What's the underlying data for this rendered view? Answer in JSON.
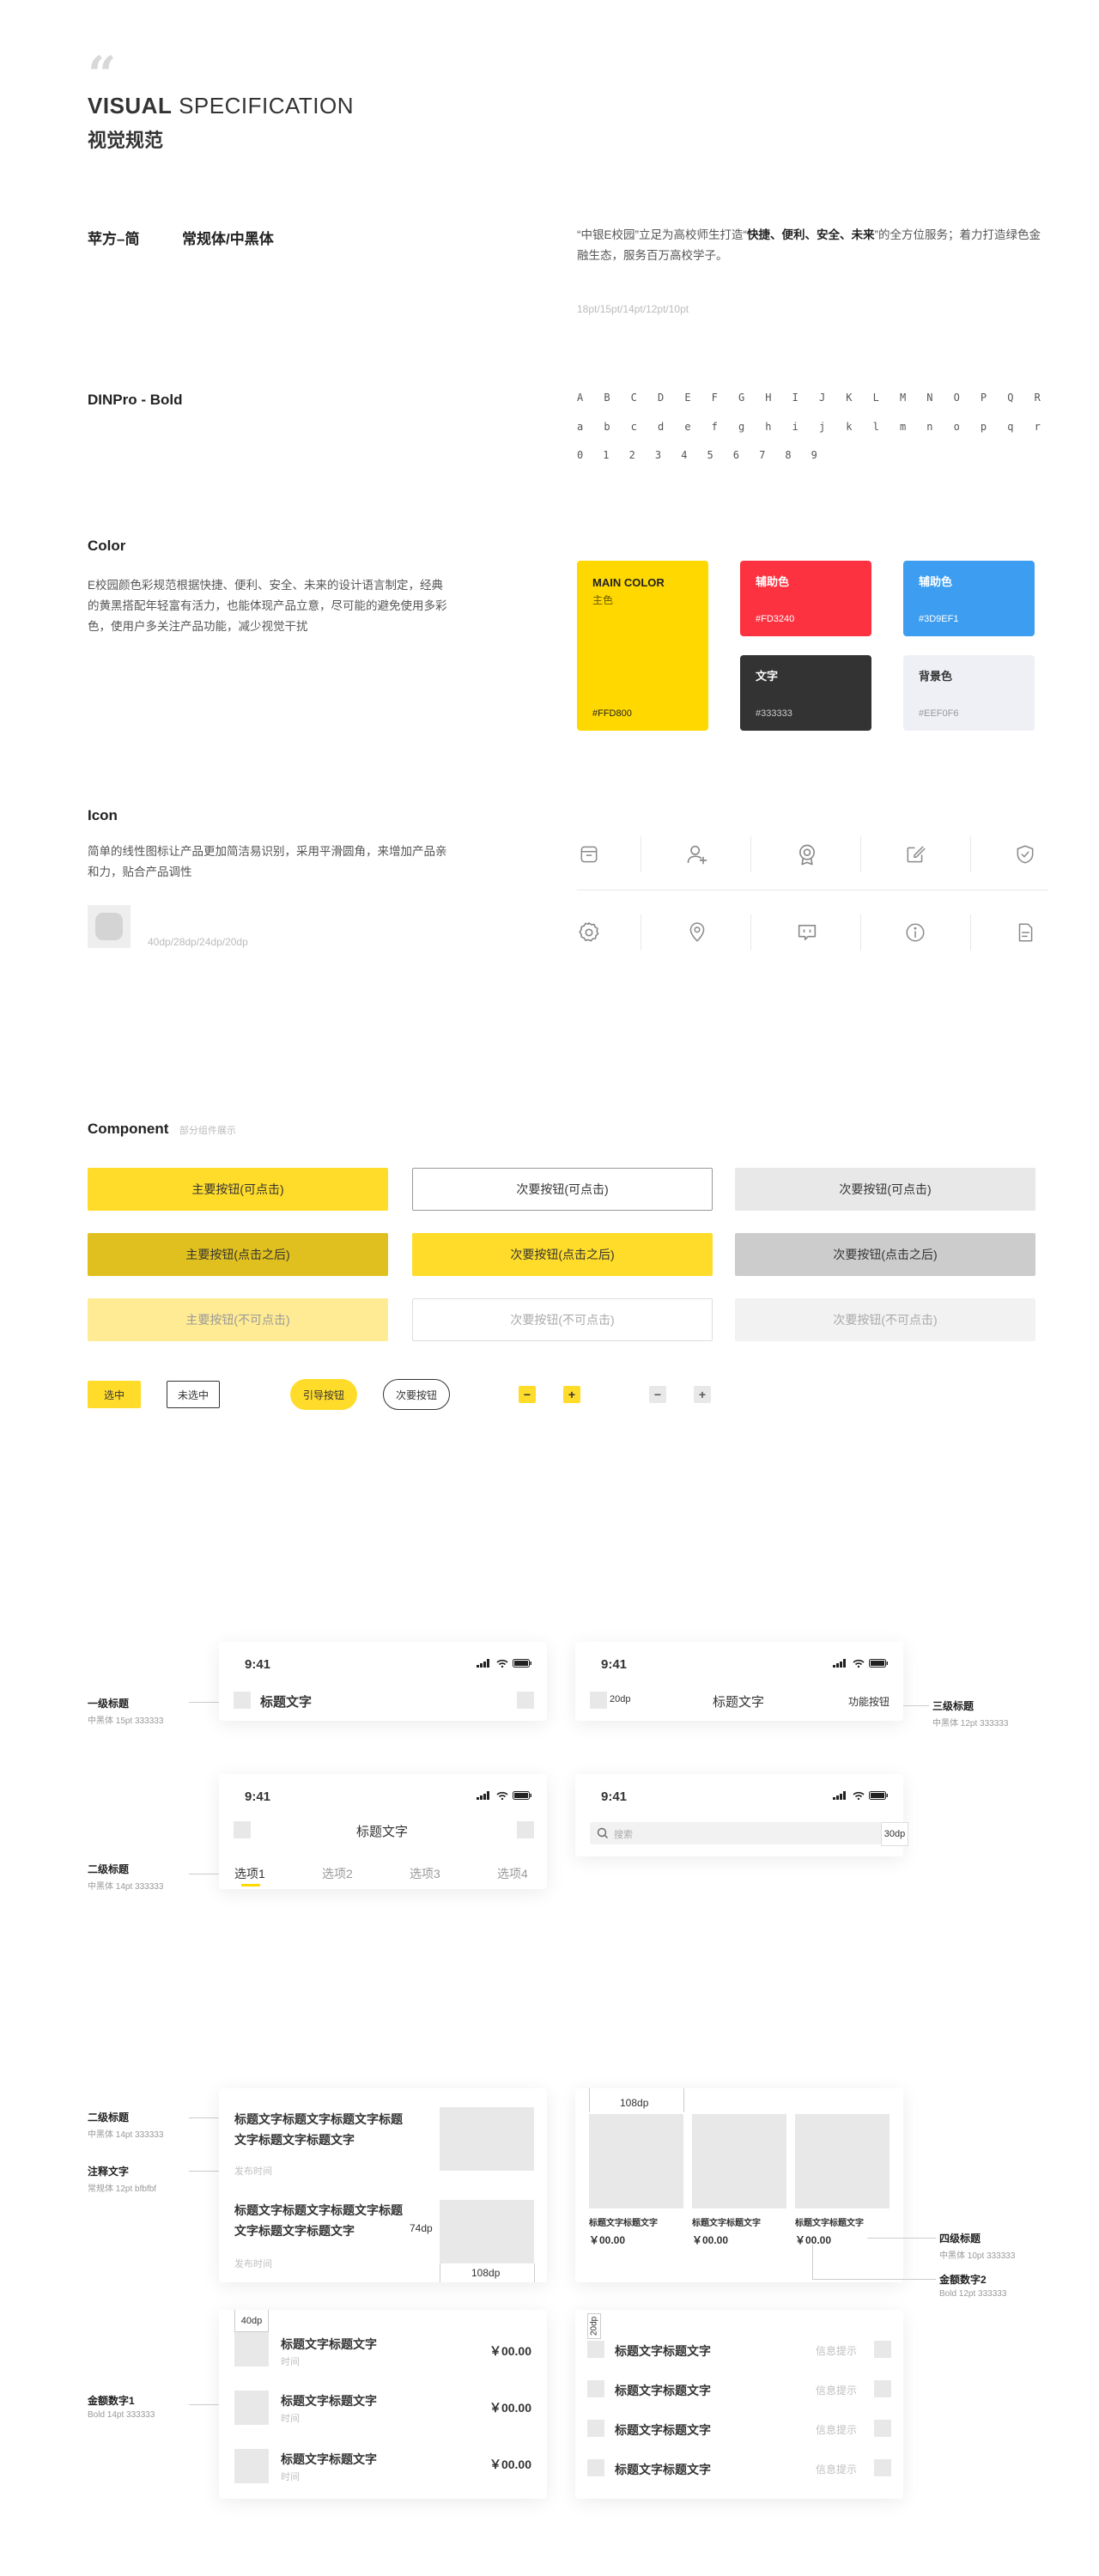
{
  "header": {
    "title_bold": "VISUAL",
    "title_rest": " SPECIFICATION",
    "subtitle": "视觉规范"
  },
  "fonts": {
    "cn_name": "苹方–简",
    "cn_weights": "常规体/中黑体",
    "sample_pre": "“中银E校园”立足为高校师生打造“",
    "sample_bold": "快捷、便利、安全、未来",
    "sample_post": "”的全方位服务；着力打造绿色金融生态，服务百万高校学子。",
    "sizes": "18pt/15pt/14pt/12pt/10pt",
    "din_name": "DINPro - Bold",
    "upper": [
      "A",
      "B",
      "C",
      "D",
      "E",
      "F",
      "G",
      "H",
      "I",
      "J",
      "K",
      "L",
      "M",
      "N",
      "O",
      "P",
      "Q",
      "R"
    ],
    "lower": [
      "a",
      "b",
      "c",
      "d",
      "e",
      "f",
      "g",
      "h",
      "i",
      "j",
      "k",
      "l",
      "m",
      "n",
      "o",
      "p",
      "q",
      "r"
    ],
    "digits": [
      "0",
      "1",
      "2",
      "3",
      "4",
      "5",
      "6",
      "7",
      "8",
      "9"
    ]
  },
  "color": {
    "title": "Color",
    "desc": "E校园颜色彩规范根据快捷、便利、安全、未来的设计语言制定，经典的黄黑搭配年轻富有活力，也能体现产品立意，尽可能的避免使用多彩色，使用户多关注产品功能，减少视觉干扰",
    "main_name": "MAIN COLOR",
    "main_sub": "主色",
    "main_hex": "#FFD800",
    "red_name": "辅助色",
    "red_hex": "#FD3240",
    "blue_name": "辅助色",
    "blue_hex": "#3D9EF1",
    "text_name": "文字",
    "text_hex": "#333333",
    "bg_name": "背景色",
    "bg_hex": "#EEF0F6"
  },
  "icon": {
    "title": "Icon",
    "desc": "简单的线性图标让产品更加简洁易识别，采用平滑圆角，来增加产品亲和力，贴合产品调性",
    "sizes": "40dp/28dp/24dp/20dp",
    "row1": [
      "shop-icon",
      "add-user-icon",
      "badge-icon",
      "edit-icon",
      "shield-check-icon"
    ],
    "row2": [
      "settings-icon",
      "location-icon",
      "chat-icon",
      "info-icon",
      "document-icon"
    ]
  },
  "component": {
    "title": "Component",
    "note": "部分组件展示",
    "buttons": [
      [
        "主要按钮(可点击)",
        "次要按钮(可点击)",
        "次要按钮(可点击)"
      ],
      [
        "主要按钮(点击之后)",
        "次要按钮(点击之后)",
        "次要按钮(点击之后)"
      ],
      [
        "主要按钮(不可点击)",
        "次要按钮(不可点击)",
        "次要按钮(不可点击)"
      ]
    ],
    "selected": "选中",
    "unselected": "未选中",
    "guide": "引导按钮",
    "secondary": "次要按钮",
    "minus": "−",
    "plus": "+"
  },
  "nav": {
    "time": "9:41",
    "title": "标题文字",
    "func": "功能按钮",
    "dp20": "20dp",
    "dp30": "30dp",
    "search_placeholder": "搜索",
    "tabs": [
      "选项1",
      "选项2",
      "选项3",
      "选项4"
    ],
    "ann1_title": "一级标题",
    "ann1_sub": "中黑体  15pt  333333",
    "ann2_title": "二级标题",
    "ann2_sub": "中黑体  14pt  333333",
    "ann3_title": "三级标题",
    "ann3_sub": "中黑体  12pt  333333"
  },
  "lists": {
    "ann_l2_title": "二级标题",
    "ann_l2_sub": "中黑体  14pt  333333",
    "ann_note_title": "注释文字",
    "ann_note_sub": "常规体  12pt  bfbfbf",
    "ann_l4_title": "四级标题",
    "ann_l4_sub": "中黑体  10pt  333333",
    "ann_m2_title": "金额数字2",
    "ann_m2_sub": "Bold  12pt  333333",
    "ann_m1_title": "金额数字1",
    "ann_m1_sub": "Bold  14pt  333333",
    "news_title_1": "标题文字标题文字标题文字标题",
    "news_title_2": "文字标题文字标题文字",
    "news_time": "发布时间",
    "dp74": "74dp",
    "dp108": "108dp",
    "dp40": "40dp",
    "dp20": "20dp",
    "product_title": "标题文字标题文字",
    "product_price": "￥00.00",
    "amount_title": "标题文字标题文字",
    "amount_time": "时间",
    "amount": "￥00.00",
    "check_title": "标题文字标题文字",
    "check_hint": "信息提示"
  }
}
